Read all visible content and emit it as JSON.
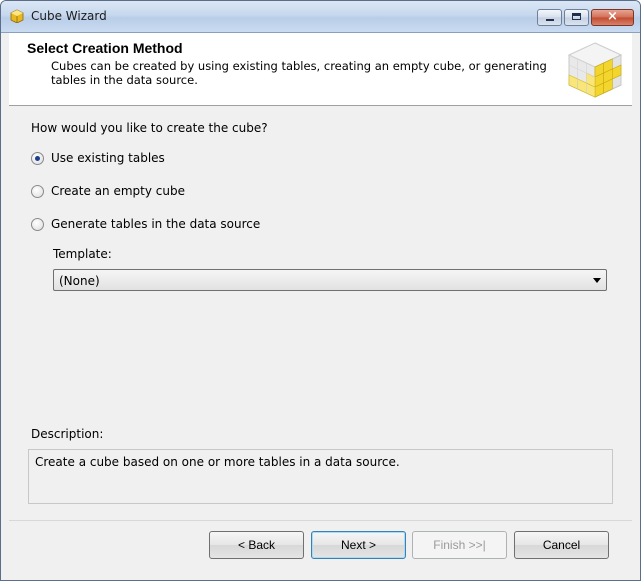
{
  "window": {
    "title": "Cube Wizard"
  },
  "header": {
    "title": "Select Creation Method",
    "description": "Cubes can be created by using existing tables, creating an empty cube, or generating tables in the data source."
  },
  "body": {
    "question": "How would you like to create the cube?",
    "options": [
      {
        "label": "Use existing tables",
        "checked": true
      },
      {
        "label": "Create an empty cube",
        "checked": false
      },
      {
        "label": "Generate tables in the data source",
        "checked": false
      }
    ],
    "template_label": "Template:",
    "template_value": "(None)",
    "description_label": "Description:",
    "description_text": "Create a cube based on one or more tables in a data source."
  },
  "buttons": {
    "back": "< Back",
    "next": "Next >",
    "finish": "Finish >>|",
    "cancel": "Cancel"
  },
  "icons": {
    "app": "cube-icon",
    "header": "cube-grid-icon",
    "minimize": "minimize-icon",
    "maximize": "maximize-icon",
    "close": "close-icon",
    "dropdown": "chevron-down-icon"
  },
  "colors": {
    "titlebar": "#c7d8ee",
    "cube_yellow": "#f3d530",
    "selected_radio": "#1b3f8c"
  }
}
